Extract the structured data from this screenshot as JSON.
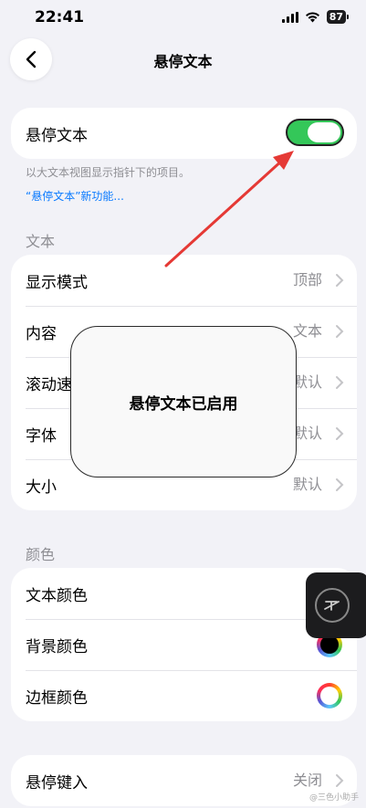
{
  "status_bar": {
    "time": "22:41",
    "battery": "87"
  },
  "nav": {
    "title": "悬停文本"
  },
  "hover_text_card": {
    "label": "悬停文本",
    "toggle_on": true
  },
  "footnote": {
    "description": "以大文本视图显示指针下的项目。",
    "link": "“悬停文本”新功能..."
  },
  "text_section": {
    "header": "文本",
    "rows": [
      {
        "label": "显示模式",
        "value": "顶部"
      },
      {
        "label": "内容",
        "value": "文本"
      },
      {
        "label": "滚动速度",
        "value": "默认"
      },
      {
        "label": "字体",
        "value": "默认"
      },
      {
        "label": "大小",
        "value": "默认"
      }
    ]
  },
  "color_section": {
    "header": "颜色",
    "rows": [
      {
        "label": "文本颜色"
      },
      {
        "label": "背景颜色"
      },
      {
        "label": "边框颜色"
      }
    ]
  },
  "hover_typing": {
    "label": "悬停键入",
    "value": "关闭"
  },
  "popup": {
    "text": "悬停文本已启用"
  },
  "colors": {
    "toggle_green": "#34c759",
    "link_blue": "#0a7aff",
    "arrow_red": "#e53935"
  },
  "watermark": "@三色小助手"
}
